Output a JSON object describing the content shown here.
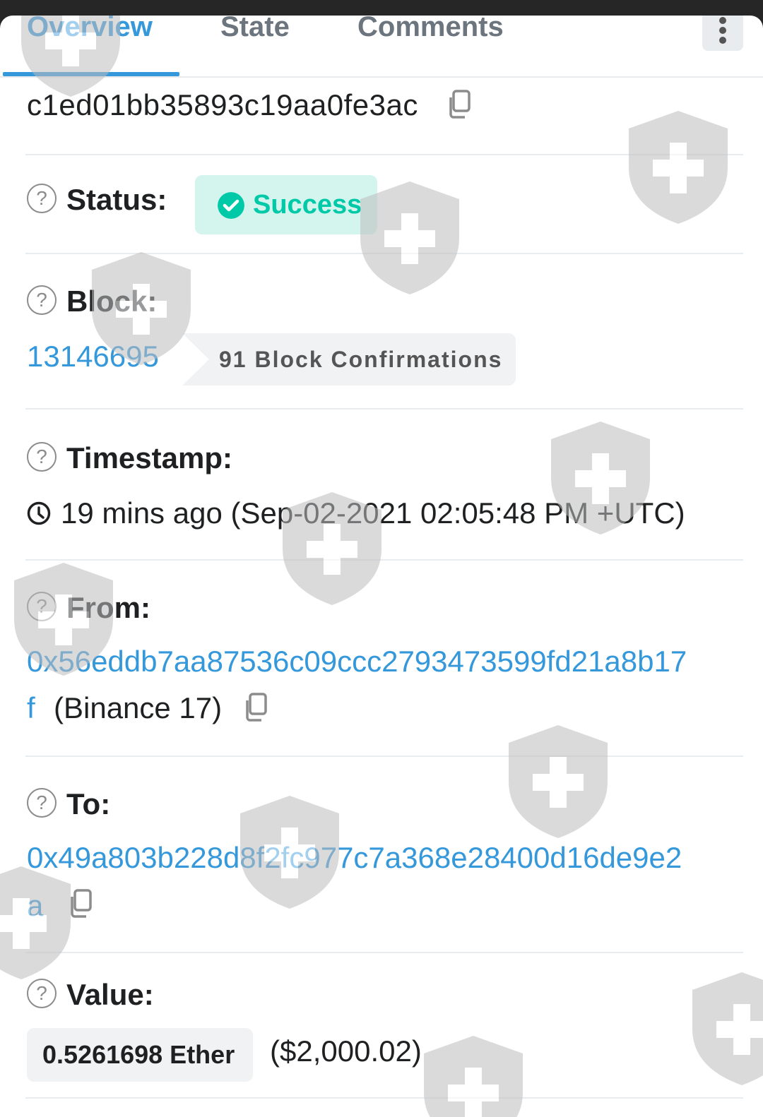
{
  "tabs": [
    {
      "label": "Overview"
    },
    {
      "label": "State"
    },
    {
      "label": "Comments"
    }
  ],
  "tx_hash_fragment": "c1ed01bb35893c19aa0fe3ac",
  "status": {
    "label": "Status:",
    "value": "Success"
  },
  "block": {
    "label": "Block:",
    "number": "13146695",
    "confirmations": "91 Block Confirmations"
  },
  "timestamp": {
    "label": "Timestamp:",
    "value": "19 mins ago (Sep-02-2021 02:05:48 PM +UTC)"
  },
  "from": {
    "label": "From:",
    "address_line1": "0x56eddb7aa87536c09ccc2793473599fd21a8b17",
    "address_line2": "f",
    "name": "(Binance 17)"
  },
  "to": {
    "label": "To:",
    "address_line1": "0x49a803b228d8f2fc977c7a368e28400d16de9e2",
    "address_line2": "a"
  },
  "value": {
    "label": "Value:",
    "amount": "0.5261698 Ether",
    "usd": "($2,000.02)"
  },
  "colors": {
    "accent": "#3498db",
    "success": "#00c9a7",
    "text": "#1e2022"
  },
  "icons": {
    "help": "question-circle-icon",
    "copy": "copy-icon",
    "clock": "clock-icon",
    "success": "check-circle-icon",
    "menu": "vertical-dots-icon"
  }
}
